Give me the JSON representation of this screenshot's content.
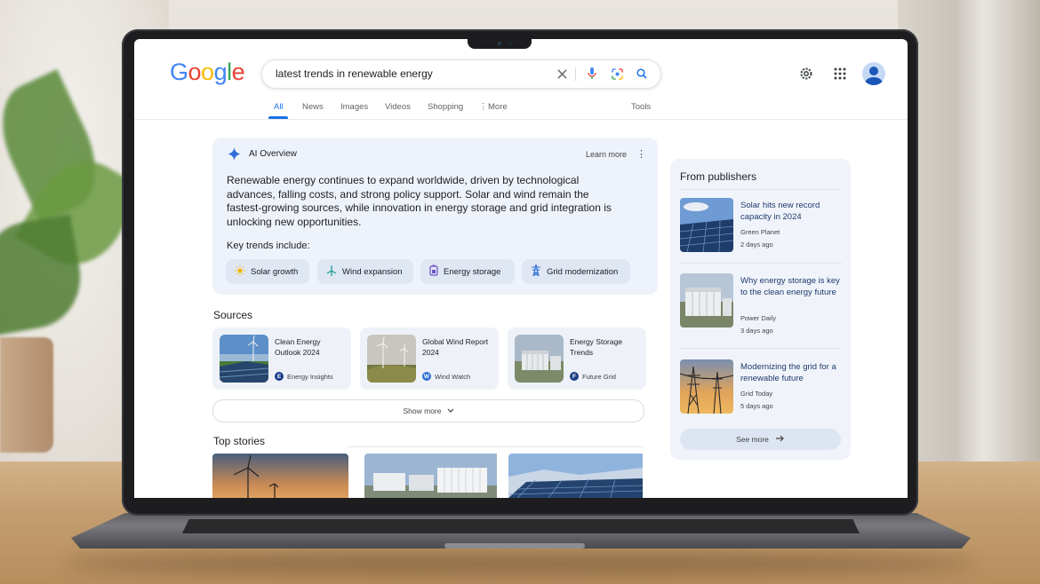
{
  "search": {
    "query": "latest trends in renewable energy"
  },
  "tabs": [
    "All",
    "News",
    "Images",
    "Videos",
    "Shopping",
    "More",
    "Tools"
  ],
  "logo_text": "Google",
  "ai_overview": {
    "title": "AI Overview",
    "learn_more": "Learn more",
    "body": "Renewable energy continues to expand worldwide, driven by technological advances, falling costs, and strong policy support. Solar and wind remain the fastest-growing sources, while innovation in energy storage and grid integration is unlocking new opportunities.",
    "key_label": "Key trends include:",
    "chips": [
      "Solar growth",
      "Wind expansion",
      "Energy storage",
      "Grid modernization"
    ]
  },
  "sources": {
    "heading": "Sources",
    "items": [
      {
        "title": "Clean Energy Outlook 2024",
        "publisher": "Energy Insights",
        "initial": "E"
      },
      {
        "title": "Global Wind Report 2024",
        "publisher": "Wind Watch",
        "initial": "W"
      },
      {
        "title": "Energy Storage Trends",
        "publisher": "Future Grid",
        "initial": "F"
      }
    ],
    "show_more": "Show more"
  },
  "top_stories": {
    "heading": "Top stories"
  },
  "publishers": {
    "heading": "From publishers",
    "items": [
      {
        "title": "Solar hits new record capacity in 2024",
        "source": "Green Planet",
        "age": "2 days ago"
      },
      {
        "title": "Why energy storage is key to the clean energy future",
        "source": "Power Daily",
        "age": "3 days ago"
      },
      {
        "title": "Modernizing the grid for a renewable future",
        "source": "Grid Today",
        "age": "5 days ago"
      }
    ],
    "see_more": "See more"
  },
  "colors": {
    "accent": "#1a73e8",
    "ai_card_bg": "#eef3fb",
    "publisher_title": "#1f3a6e"
  }
}
